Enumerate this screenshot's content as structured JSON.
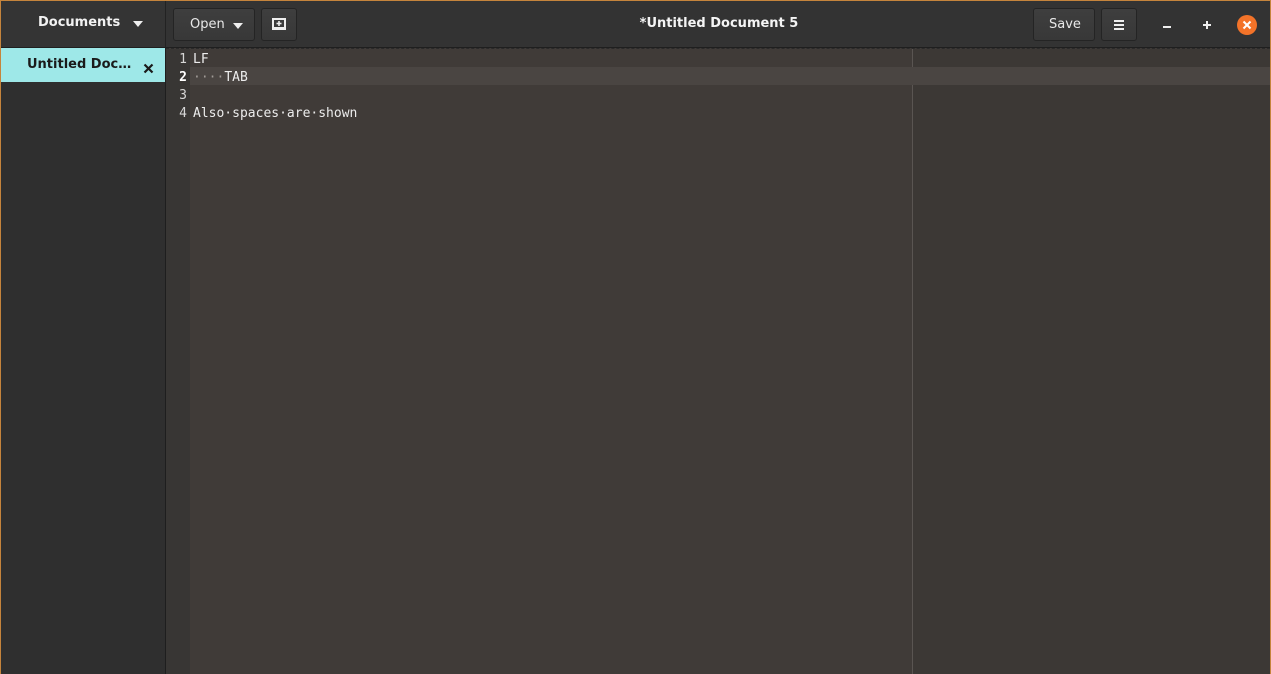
{
  "sidebar": {
    "title": "Documents",
    "documents": [
      {
        "label": "Untitled Docum..."
      }
    ]
  },
  "toolbar": {
    "open_label": "Open",
    "save_label": "Save"
  },
  "window": {
    "title": "*Untitled Document 5"
  },
  "editor": {
    "lines": [
      {
        "number": "1",
        "text": "LF"
      },
      {
        "number": "2",
        "ws": "····",
        "text": "TAB"
      },
      {
        "number": "3",
        "text": ""
      },
      {
        "number": "4",
        "text": "Also·spaces·are·shown"
      }
    ],
    "current_line": 2
  },
  "colors": {
    "accent": "#f37329",
    "selected_document": "#9ee8e8",
    "editor_background": "#403b38"
  }
}
